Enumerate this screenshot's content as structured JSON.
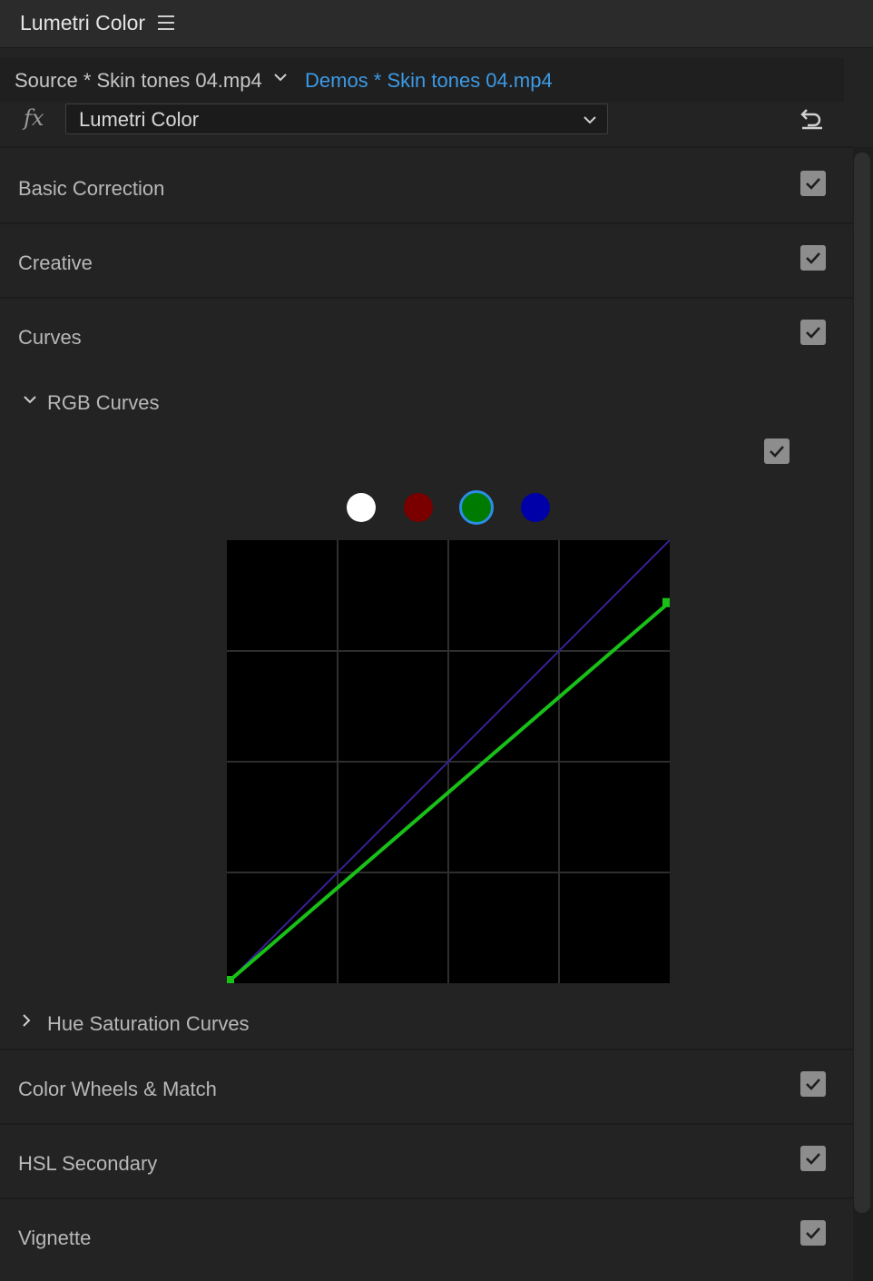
{
  "panel": {
    "title": "Lumetri Color",
    "menu_icon": "hamburger-menu-icon"
  },
  "clip": {
    "source_label": "Source * Skin tones 04.mp4",
    "sequence_link": "Demos * Skin tones 04.mp4"
  },
  "effect": {
    "fx_symbol": "fx",
    "selected": "Lumetri Color",
    "reset_icon": "reset-icon"
  },
  "sections": {
    "basic_correction": {
      "label": "Basic Correction",
      "enabled": true
    },
    "creative": {
      "label": "Creative",
      "enabled": true
    },
    "curves": {
      "label": "Curves",
      "enabled": true
    },
    "color_wheels": {
      "label": "Color Wheels & Match",
      "enabled": true
    },
    "hsl_secondary": {
      "label": "HSL Secondary",
      "enabled": true
    },
    "vignette": {
      "label": "Vignette",
      "enabled": true
    }
  },
  "rgb_curves": {
    "label": "RGB Curves",
    "expanded": true,
    "enabled": true,
    "channels": [
      {
        "name": "white",
        "color": "#ffffff",
        "selected": false
      },
      {
        "name": "red",
        "color": "#7a0000",
        "selected": false
      },
      {
        "name": "green",
        "color": "#007a00",
        "selected": true
      },
      {
        "name": "blue",
        "color": "#0000a8",
        "selected": false
      }
    ],
    "selection_ring_color": "#2a8ee6",
    "curve_color": "#18c018",
    "diagonal_color": "#3a1f9a",
    "grid_color": "#2e2e2e",
    "green_curve_points": [
      [
        0,
        0
      ],
      [
        1,
        0.86
      ]
    ]
  },
  "hue_saturation_curves": {
    "label": "Hue Saturation Curves",
    "expanded": false
  },
  "colors": {
    "accent_link": "#3c9ae6",
    "checkbox": "#8d8d8d",
    "background": "#232323"
  }
}
